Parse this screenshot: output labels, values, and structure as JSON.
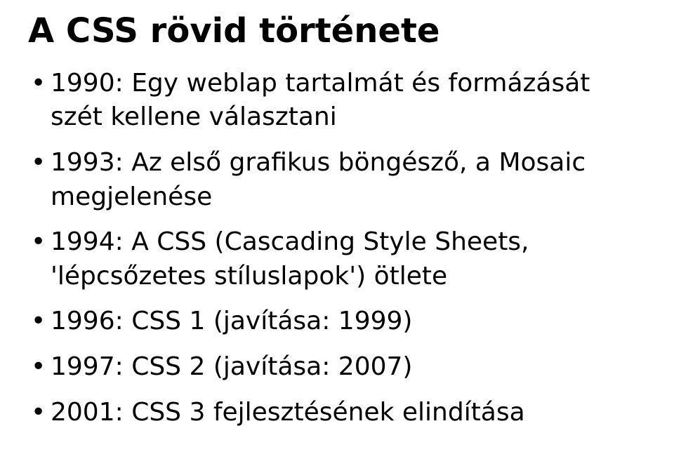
{
  "title": "A CSS rövid története",
  "bullets": [
    "1990: Egy weblap tartalmát és formázását szét kellene választani",
    "1993: Az első grafikus böngésző, a Mosaic megjelenése",
    "1994: A CSS (Cascading Style Sheets, 'lépcsőzetes stíluslapok') ötlete",
    "1996: CSS 1 (javítása: 1999)",
    "1997: CSS 2 (javítása: 2007)",
    "2001: CSS 3 fejlesztésének elindítása"
  ]
}
